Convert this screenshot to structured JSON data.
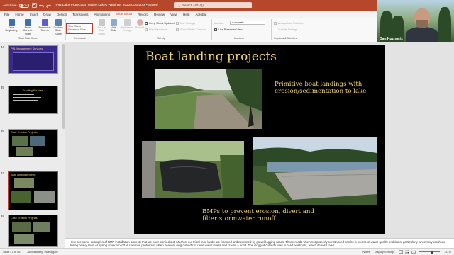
{
  "titlebar": {
    "autosave_label": "AutoSave",
    "autosave_state": "On",
    "doc_title": "PIN Lake Protection_Maine Lakes Webinar_20220330.pptx • Saved",
    "search_placeholder": "Search (Alt+Q)"
  },
  "tabs": [
    "File",
    "Home",
    "Insert",
    "Draw",
    "Design",
    "Transitions",
    "Animations",
    "Slide Show",
    "Record",
    "Review",
    "View",
    "Help",
    "Acrobat"
  ],
  "ribbon": {
    "start": {
      "from_beginning": "From Beginning",
      "from_current": "From Current Slide",
      "present_teams": "Present in Teams",
      "custom": "Custom Slide Show",
      "group": "Start Slide Show"
    },
    "setup": {
      "set_up": "Set Up Slide Show",
      "hide": "Hide Slide",
      "rehearse": "Rehearse Timings",
      "record": "Record",
      "group": "Set Up"
    },
    "rehearsal_box": {
      "line1": "Slide Show",
      "line2": "Rehearse Slide Show"
    },
    "rehearsal_group": "Rehearsal",
    "checks": {
      "keep_updated": "Keep Slides Updated",
      "play_narrations": "Play Narrations",
      "use_timings": "Use Timings",
      "show_media": "Show Media Controls",
      "monitor_label": "Monitor:",
      "monitor_value": "Automatic",
      "presenter_view": "Use Presenter View",
      "monitors_group": "Monitors",
      "always_subtitles": "Always Use Subtitles",
      "subtitle_settings": "Subtitle Settings",
      "captions_group": "Captions & Subtitles"
    }
  },
  "webcam": {
    "name": "Dan Kuzmeriz"
  },
  "thumbnails": [
    {
      "num": "34",
      "title": "PIN Management Services"
    },
    {
      "num": "35",
      "title": "Funding Sources"
    },
    {
      "num": "36",
      "title": "Case Erosion Projects"
    },
    {
      "num": "37",
      "title": "Boat landing projects"
    },
    {
      "num": "38",
      "title": "Case Erosion Projects"
    }
  ],
  "slide": {
    "title": "Boat landing projects",
    "text_top": "Primitive boat landings with erosion/sedimentation to lake",
    "text_bottom": "BMPs to prevent erosion, divert and filter stormwater runoff"
  },
  "notes": "Here are some examples of BMP installation projects that we have carried out. Much of our tribal trust lands are forested and accessed by gravel logging roads. Those roads when not properly constructed can be a source of water quality problems, particularly when they wash out during heavy rains or spring snow run-off. A common problem is when beavers clog culverts to raise water levels and create a pond. The clogged culverts lead to road washouts, which deposit road",
  "status": {
    "slide_of": "Slide 37 of 56",
    "accessibility": "Accessibility: Investigate",
    "notes": "Notes",
    "display": "Display Settings",
    "zoom": "111%"
  }
}
